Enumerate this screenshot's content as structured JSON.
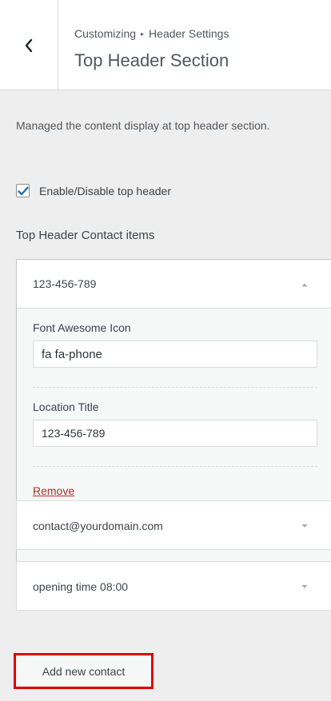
{
  "header": {
    "breadcrumb_parent": "Customizing",
    "breadcrumb_separator": "▸",
    "breadcrumb_current": "Header Settings",
    "title": "Top Header Section"
  },
  "section": {
    "description": "Managed the content display at top header section.",
    "checkbox_label": "Enable/Disable top header",
    "checkbox_checked": true,
    "items_heading": "Top Header Contact items"
  },
  "items": [
    {
      "title": "123-456-789",
      "expanded": true,
      "icon_label": "Font Awesome Icon",
      "icon_value": "fa fa-phone",
      "location_label": "Location Title",
      "location_value": "123-456-789",
      "remove_label": "Remove"
    },
    {
      "title": "contact@yourdomain.com",
      "expanded": false
    },
    {
      "title": "opening time 08:00",
      "expanded": false
    }
  ],
  "add_button_label": "Add new contact",
  "colors": {
    "accent": "#2271b1",
    "highlight": "#e00000",
    "danger": "#b32d2e"
  }
}
